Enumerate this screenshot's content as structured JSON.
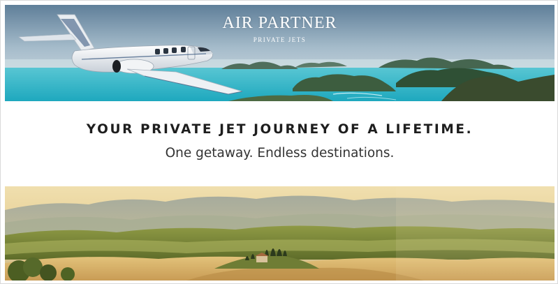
{
  "brand": {
    "name": "AIR PARTNER",
    "tagline": "PRIVATE JETS"
  },
  "banner": {
    "headline": "YOUR PRIVATE JET JOURNEY OF A LIFETIME.",
    "subheadline": "One getaway. Endless destinations."
  },
  "colors": {
    "sky_top": "#6f8fa8",
    "sea": "#33b7c9",
    "headline_text": "#1e1e1e",
    "hills_green": "#7a8a3a",
    "golden_sky": "#e8d39c"
  },
  "images": {
    "top": "private-jet-over-tropical-islands",
    "bottom": "rolling-tuscan-hills-with-cypress-trees"
  }
}
